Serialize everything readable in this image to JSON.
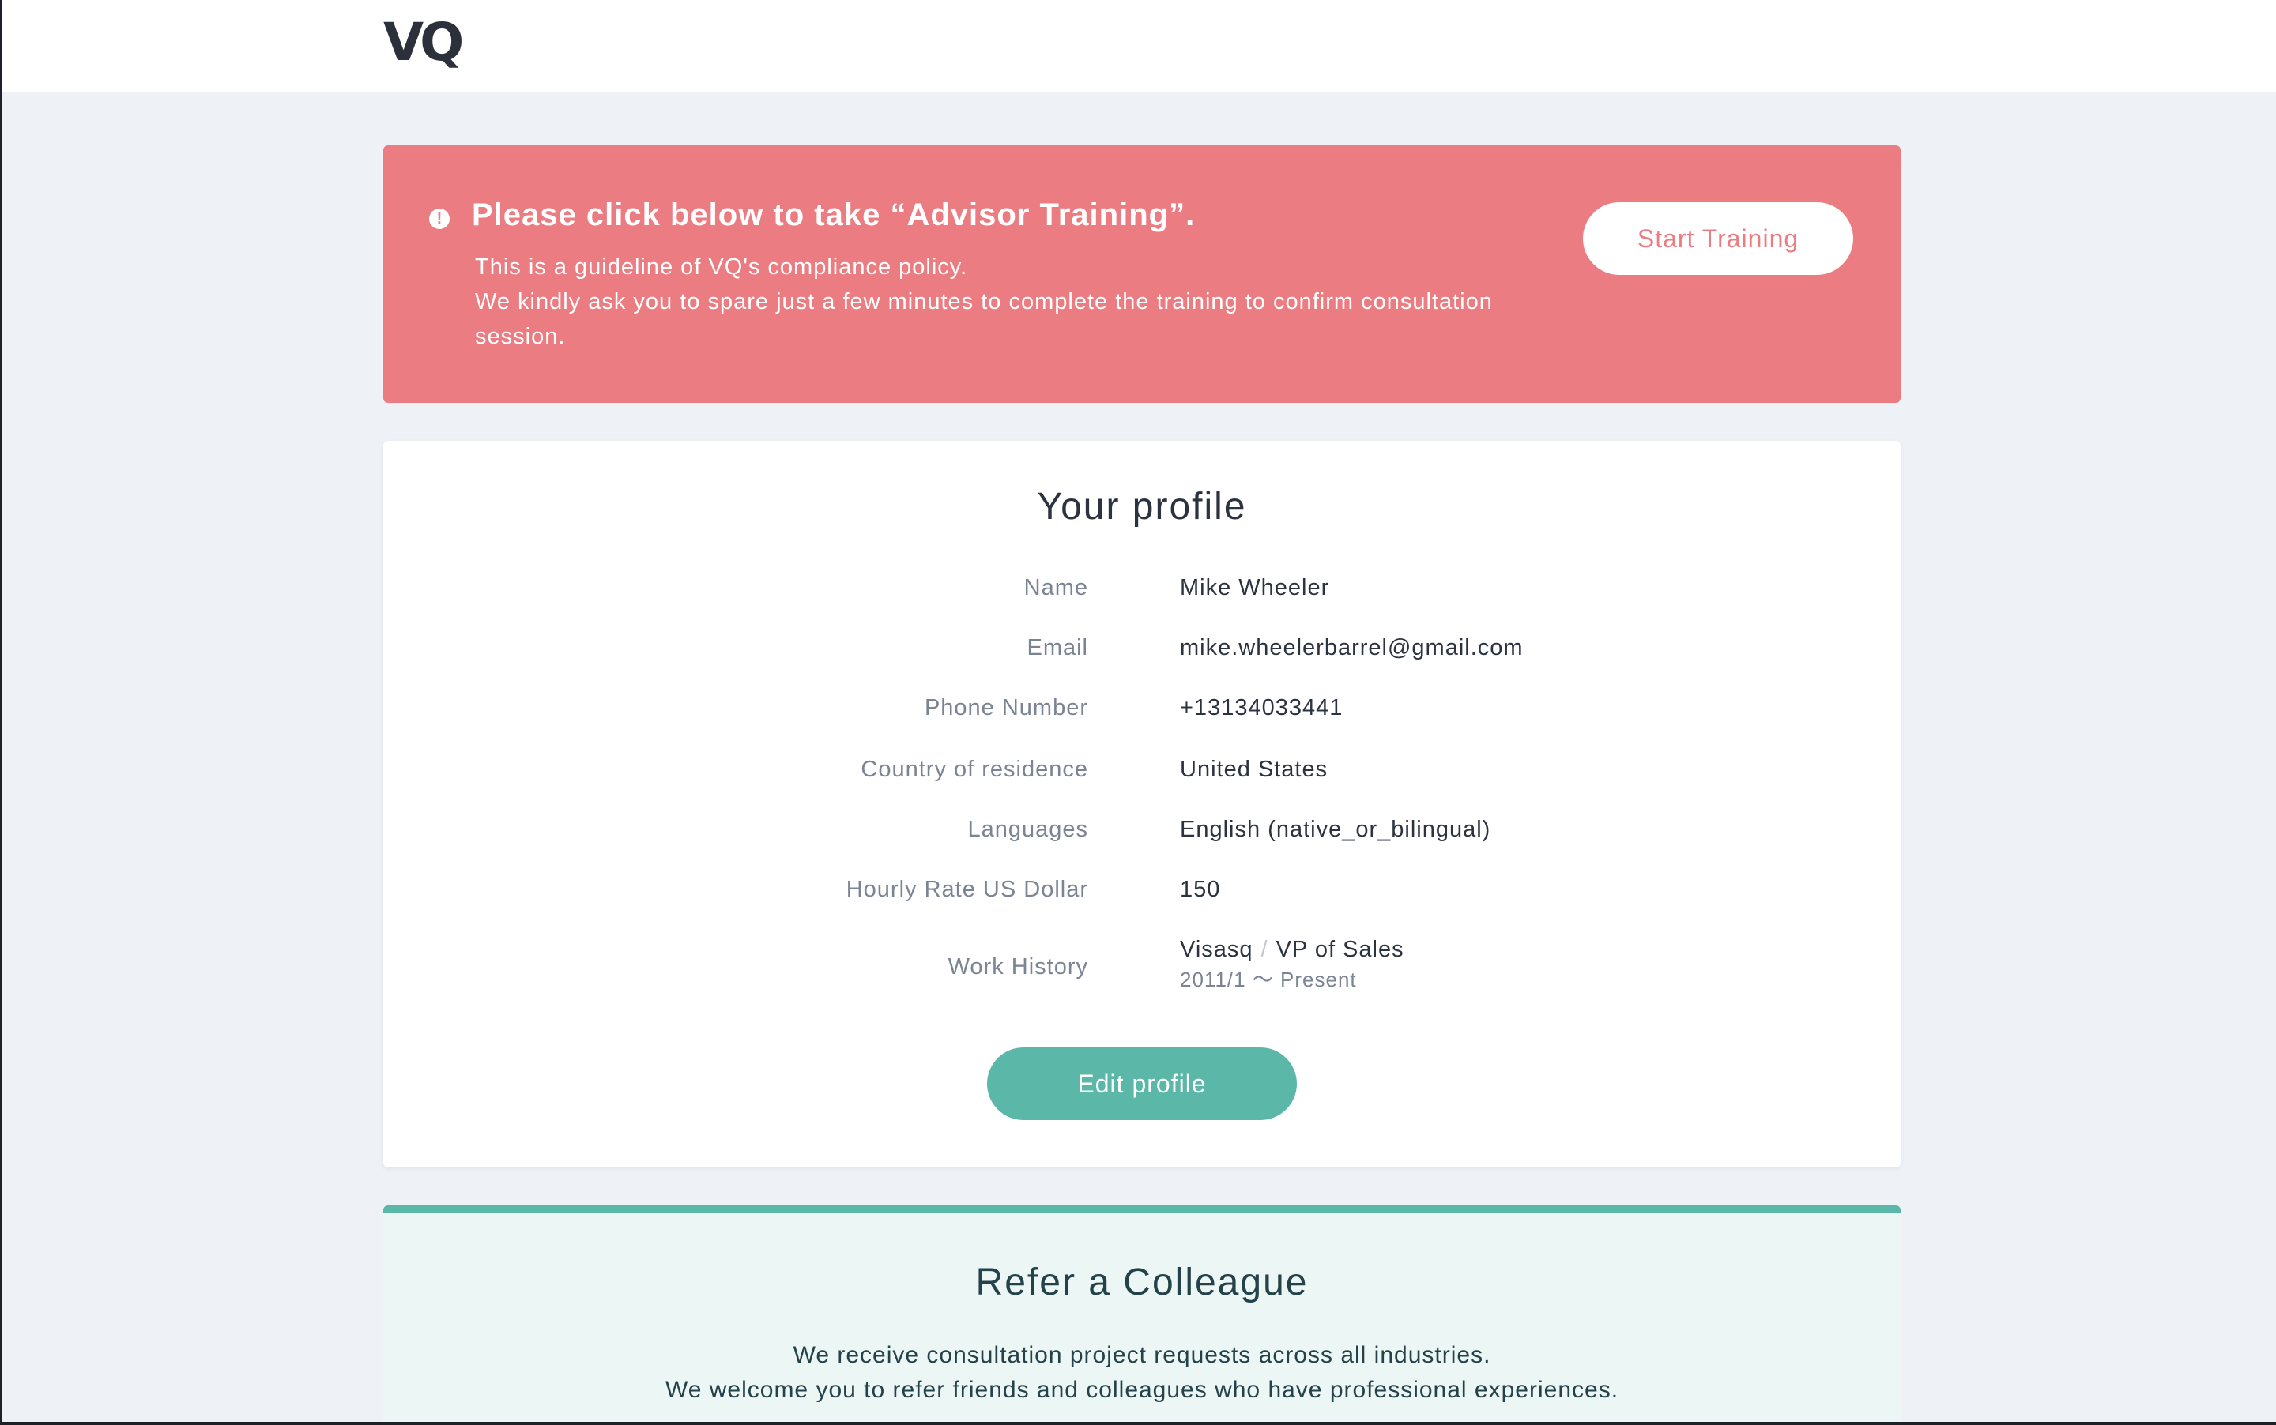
{
  "header": {
    "logo": "VQ"
  },
  "alert": {
    "icon": "exclamation-circle-icon",
    "icon_glyph": "!",
    "title": "Please click below to take “Advisor Training”.",
    "line1": "This is a guideline of VQ's compliance policy.",
    "line2": "We kindly ask you to spare just a few minutes to complete the training to confirm consultation session.",
    "button_label": "Start Training",
    "color": "#eb7d82"
  },
  "profile": {
    "title": "Your profile",
    "fields": [
      {
        "label": "Name",
        "value": "Mike Wheeler"
      },
      {
        "label": "Email",
        "value": "mike.wheelerbarrel@gmail.com"
      },
      {
        "label": "Phone Number",
        "value": "+13134033441"
      },
      {
        "label": "Country of residence",
        "value": "United States"
      },
      {
        "label": "Languages",
        "value": "English (native_or_bilingual)"
      },
      {
        "label": "Hourly Rate US Dollar",
        "value": "150"
      }
    ],
    "work_history": {
      "label": "Work History",
      "company": "Visasq",
      "separator": "/",
      "position": "VP of Sales",
      "dates": "2011/1 〜 Present"
    },
    "edit_button": "Edit profile"
  },
  "refer": {
    "title": "Refer a Colleague",
    "line1": "We receive consultation project requests across all industries.",
    "line2": "We welcome you to refer friends and colleagues who have professional experiences.",
    "accent": "#5bb8a8"
  }
}
